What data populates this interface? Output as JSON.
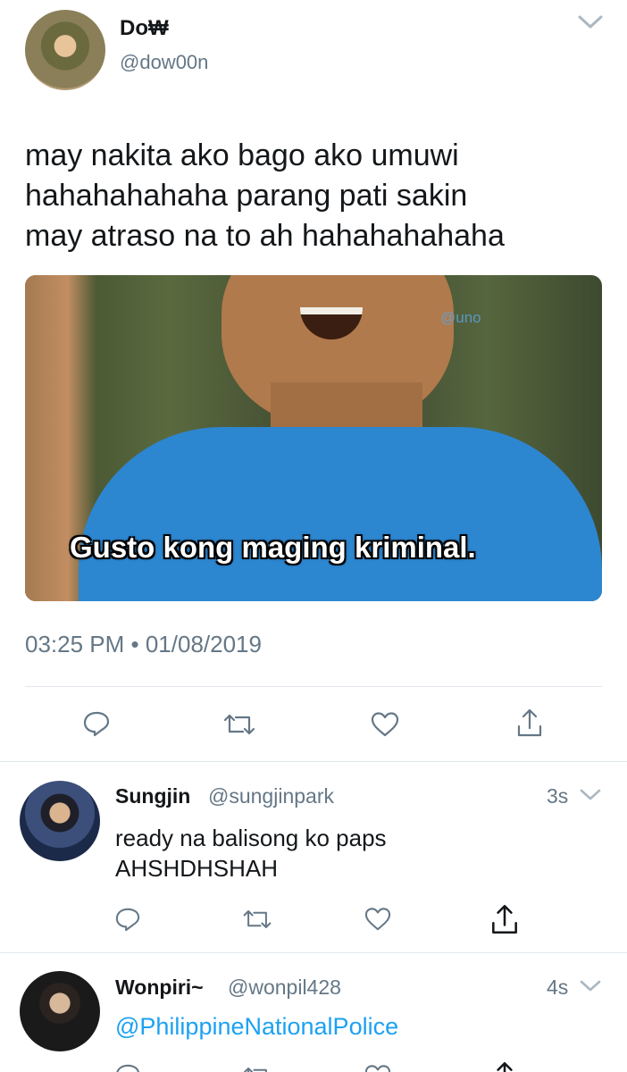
{
  "tweet": {
    "author_name": "Do₩",
    "author_handle": "@dow00n",
    "text_lines": [
      "may nakita ako bago ako umuwi",
      "hahahahahaha parang pati sakin",
      "may atraso na to ah hahahahahaha"
    ],
    "media_caption": "Gusto kong maging kriminal.",
    "media_watermark": "@uno",
    "timestamp": "03:25 PM • 01/08/2019"
  },
  "replies": [
    {
      "name": "Sungjin",
      "handle": "@sungjinpark",
      "time": "3s",
      "text_lines": [
        "ready na balisong ko paps",
        "AHSHDHSHAH"
      ]
    },
    {
      "name": "Wonpiri~",
      "handle": "@wonpil428",
      "time": "4s",
      "mention": "@PhilippineNationalPolice"
    }
  ],
  "colors": {
    "text": "#14171a",
    "muted": "#657786",
    "link": "#1da1f2",
    "divider": "#e1e8ed",
    "photo_shirt": "#2d86d0"
  },
  "icons": [
    "reply-icon",
    "retweet-icon",
    "like-icon",
    "share-icon",
    "chevron-down-icon"
  ]
}
